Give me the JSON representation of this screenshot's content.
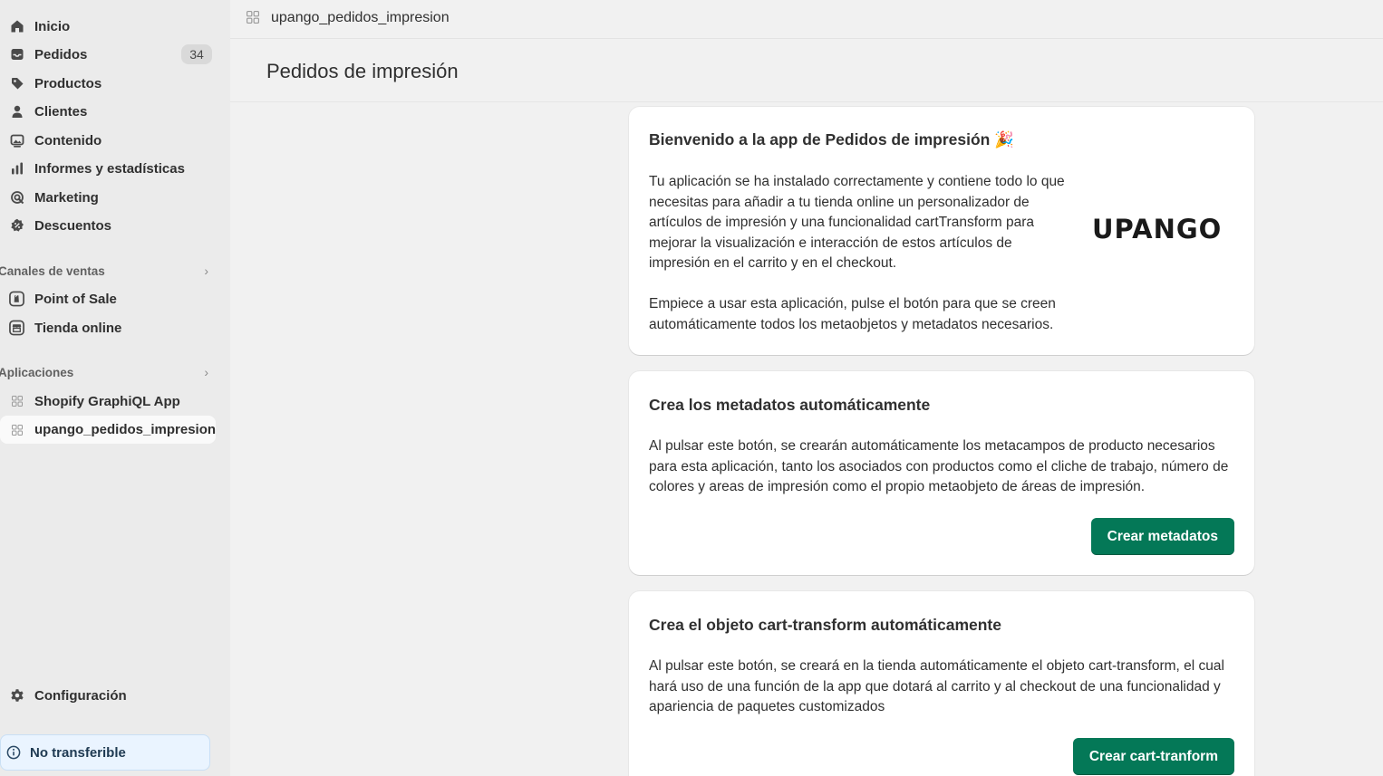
{
  "sidebar": {
    "items": [
      {
        "label": "Inicio",
        "icon": "home-icon"
      },
      {
        "label": "Pedidos",
        "icon": "inbox-icon",
        "badge": "34"
      },
      {
        "label": "Productos",
        "icon": "tag-icon"
      },
      {
        "label": "Clientes",
        "icon": "person-icon"
      },
      {
        "label": "Contenido",
        "icon": "image-icon"
      },
      {
        "label": "Informes y estadísticas",
        "icon": "bar-chart-icon"
      },
      {
        "label": "Marketing",
        "icon": "target-icon"
      },
      {
        "label": "Descuentos",
        "icon": "discount-icon"
      }
    ],
    "sales_channels": {
      "heading": "Canales de ventas",
      "items": [
        {
          "label": "Point of Sale",
          "icon": "pos-icon"
        },
        {
          "label": "Tienda online",
          "icon": "store-icon"
        }
      ]
    },
    "apps": {
      "heading": "Aplicaciones",
      "items": [
        {
          "label": "Shopify GraphiQL App",
          "icon": "app-icon"
        },
        {
          "label": "upango_pedidos_impresion",
          "icon": "app-icon",
          "active": true
        }
      ]
    },
    "settings": {
      "label": "Configuración",
      "icon": "gear-icon"
    },
    "notice": {
      "label": "No transferible",
      "icon": "info-icon"
    }
  },
  "topbar": {
    "title": "upango_pedidos_impresion"
  },
  "page": {
    "title": "Pedidos de impresión"
  },
  "cards": {
    "welcome": {
      "title": "Bienvenido a la app de Pedidos de impresión 🎉",
      "paragraph1": "Tu aplicación se ha instalado correctamente y contiene todo lo que necesitas para añadir a tu tienda online un personalizador de artículos de impresión y una funcionalidad cartTransform para mejorar la visualización e interacción de estos artículos de impresión en el carrito y en el checkout.",
      "paragraph2": "Empiece a usar esta aplicación, pulse el botón para que se creen automáticamente todos los metaobjetos y metadatos necesarios.",
      "logo": "UPANGO"
    },
    "metadata": {
      "title": "Crea los metadatos automáticamente",
      "body": "Al pulsar este botón, se crearán automáticamente los metacampos de producto necesarios para esta aplicación, tanto los asociados con productos como el cliche de trabajo, número de colores y areas de impresión como el propio metaobjeto de áreas de impresión.",
      "button": "Crear metadatos"
    },
    "cart_transform": {
      "title": "Crea el objeto cart-transform automáticamente",
      "body": "Al pulsar este botón, se creará en la tienda automáticamente el objeto cart-transform, el cual hará uso de una función de la app que dotará al carrito y al checkout de una funcionalidad y apariencia de paquetes customizados",
      "button": "Crear cart-tranform"
    }
  },
  "colors": {
    "accent": "#047857",
    "sidebar_bg": "#ebebeb",
    "page_bg": "#f1f1f1"
  }
}
